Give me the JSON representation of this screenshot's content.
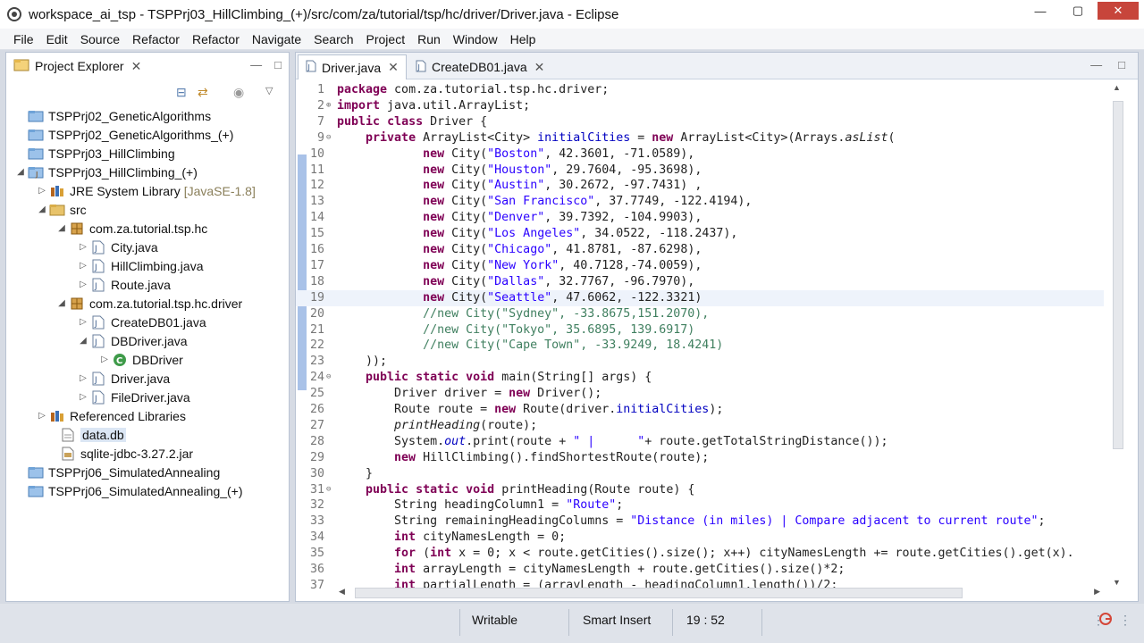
{
  "window": {
    "title": "workspace_ai_tsp - TSPPrj03_HillClimbing_(+)/src/com/za/tutorial/tsp/hc/driver/Driver.java - Eclipse"
  },
  "menu": [
    "File",
    "Edit",
    "Source",
    "Refactor",
    "Refactor",
    "Navigate",
    "Search",
    "Project",
    "Run",
    "Window",
    "Help"
  ],
  "project_explorer": {
    "title": "Project Explorer",
    "items": [
      {
        "label": "TSPPrj02_GeneticAlgorithms",
        "extra": ""
      },
      {
        "label": "TSPPrj02_GeneticAlgorithms_(+)",
        "extra": ""
      },
      {
        "label": "TSPPrj03_HillClimbing",
        "extra": ""
      },
      {
        "label": "TSPPrj03_HillClimbing_(+)",
        "extra": ""
      },
      {
        "label": "JRE System Library",
        "extra": "[JavaSE-1.8]"
      },
      {
        "label": "src",
        "extra": ""
      },
      {
        "label": "com.za.tutorial.tsp.hc",
        "extra": ""
      },
      {
        "label": "City.java",
        "extra": ""
      },
      {
        "label": "HillClimbing.java",
        "extra": ""
      },
      {
        "label": "Route.java",
        "extra": ""
      },
      {
        "label": "com.za.tutorial.tsp.hc.driver",
        "extra": ""
      },
      {
        "label": "CreateDB01.java",
        "extra": ""
      },
      {
        "label": "DBDriver.java",
        "extra": ""
      },
      {
        "label": "DBDriver",
        "extra": ""
      },
      {
        "label": "Driver.java",
        "extra": ""
      },
      {
        "label": "FileDriver.java",
        "extra": ""
      },
      {
        "label": "Referenced Libraries",
        "extra": ""
      },
      {
        "label": "data.db",
        "extra": ""
      },
      {
        "label": "sqlite-jdbc-3.27.2.jar",
        "extra": ""
      },
      {
        "label": "TSPPrj06_SimulatedAnnealing",
        "extra": ""
      },
      {
        "label": "TSPPrj06_SimulatedAnnealing_(+)",
        "extra": ""
      }
    ]
  },
  "editor": {
    "tabs": [
      "Driver.java",
      "CreateDB01.java"
    ],
    "current_line": "19",
    "lines": [
      {
        "n": "1",
        "text": "package com.za.tutorial.tsp.hc.driver;"
      },
      {
        "n": "2",
        "text": "import java.util.ArrayList;"
      },
      {
        "n": "7",
        "text": "public class Driver {"
      },
      {
        "n": "9",
        "text": "    private ArrayList<City> initialCities = new ArrayList<City>(Arrays.asList("
      },
      {
        "n": "10",
        "text": "            new City(\"Boston\", 42.3601, -71.0589),"
      },
      {
        "n": "11",
        "text": "            new City(\"Houston\", 29.7604, -95.3698),"
      },
      {
        "n": "12",
        "text": "            new City(\"Austin\", 30.2672, -97.7431) ,"
      },
      {
        "n": "13",
        "text": "            new City(\"San Francisco\", 37.7749, -122.4194),"
      },
      {
        "n": "14",
        "text": "            new City(\"Denver\", 39.7392, -104.9903),"
      },
      {
        "n": "15",
        "text": "            new City(\"Los Angeles\", 34.0522, -118.2437),"
      },
      {
        "n": "16",
        "text": "            new City(\"Chicago\", 41.8781, -87.6298),"
      },
      {
        "n": "17",
        "text": "            new City(\"New York\", 40.7128,-74.0059),"
      },
      {
        "n": "18",
        "text": "            new City(\"Dallas\", 32.7767, -96.7970),"
      },
      {
        "n": "19",
        "text": "            new City(\"Seattle\", 47.6062, -122.3321)"
      },
      {
        "n": "20",
        "text": "            //new City(\"Sydney\", -33.8675,151.2070),"
      },
      {
        "n": "21",
        "text": "            //new City(\"Tokyo\", 35.6895, 139.6917)"
      },
      {
        "n": "22",
        "text": "            //new City(\"Cape Town\", -33.9249, 18.4241)"
      },
      {
        "n": "23",
        "text": "    ));"
      },
      {
        "n": "24",
        "text": "    public static void main(String[] args) {"
      },
      {
        "n": "25",
        "text": "        Driver driver = new Driver();"
      },
      {
        "n": "26",
        "text": "        Route route = new Route(driver.initialCities);"
      },
      {
        "n": "27",
        "text": "        printHeading(route);"
      },
      {
        "n": "28",
        "text": "        System.out.print(route + \" |      \"+ route.getTotalStringDistance());"
      },
      {
        "n": "29",
        "text": "        new HillClimbing().findShortestRoute(route);"
      },
      {
        "n": "30",
        "text": "    }"
      },
      {
        "n": "31",
        "text": "    public static void printHeading(Route route) {"
      },
      {
        "n": "32",
        "text": "        String headingColumn1 = \"Route\";"
      },
      {
        "n": "33",
        "text": "        String remainingHeadingColumns = \"Distance (in miles) | Compare adjacent to current route\";"
      },
      {
        "n": "34",
        "text": "        int cityNamesLength = 0;"
      },
      {
        "n": "35",
        "text": "        for (int x = 0; x < route.getCities().size(); x++) cityNamesLength += route.getCities().get(x)."
      },
      {
        "n": "36",
        "text": "        int arrayLength = cityNamesLength + route.getCities().size()*2;"
      },
      {
        "n": "37",
        "text": "        int partialLength = (arrayLength - headingColumn1.length())/2;"
      }
    ]
  },
  "status": {
    "writable": "Writable",
    "insert_mode": "Smart Insert",
    "position": "19 : 52"
  },
  "colors": {
    "keyword": "#7f0055",
    "string": "#2a00ff",
    "comment": "#3f7f5f",
    "field": "#0000c0",
    "change_ruler": "#a9c2e8",
    "current_line": "#eef3fb"
  }
}
